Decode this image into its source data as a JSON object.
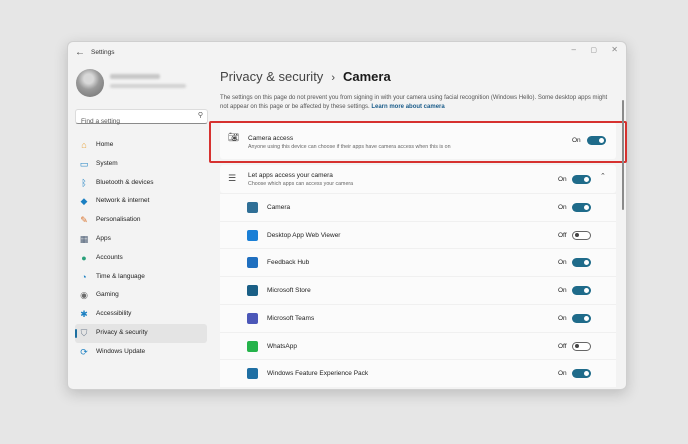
{
  "window": {
    "title": "Settings",
    "controls": {
      "minimize": "–",
      "maximize": "▢",
      "close": "✕"
    }
  },
  "sidebar": {
    "search_placeholder": "Find a setting",
    "items": [
      {
        "label": "Home",
        "icon": "home-icon",
        "color": "#e8a33a",
        "glyph": "⌂"
      },
      {
        "label": "System",
        "icon": "system-icon",
        "color": "#1a7fc2",
        "glyph": "▭"
      },
      {
        "label": "Bluetooth & devices",
        "icon": "bluetooth-icon",
        "color": "#1a7fc2",
        "glyph": "ᛒ"
      },
      {
        "label": "Network & internet",
        "icon": "network-icon",
        "color": "#1a7fc2",
        "glyph": "◆"
      },
      {
        "label": "Personalisation",
        "icon": "brush-icon",
        "color": "#d9722b",
        "glyph": "✎"
      },
      {
        "label": "Apps",
        "icon": "apps-icon",
        "color": "#4a5b72",
        "glyph": "▦"
      },
      {
        "label": "Accounts",
        "icon": "accounts-icon",
        "color": "#2aa07a",
        "glyph": "●"
      },
      {
        "label": "Time & language",
        "icon": "time-language-icon",
        "color": "#1a7fc2",
        "glyph": "◔"
      },
      {
        "label": "Gaming",
        "icon": "gaming-icon",
        "color": "#6b6b6b",
        "glyph": "◉"
      },
      {
        "label": "Accessibility",
        "icon": "accessibility-icon",
        "color": "#1a7fc2",
        "glyph": "✱"
      },
      {
        "label": "Privacy & security",
        "icon": "shield-icon",
        "color": "#6b7a8c",
        "glyph": "⛉",
        "active": true
      },
      {
        "label": "Windows Update",
        "icon": "windows-update-icon",
        "color": "#1a7fc2",
        "glyph": "⟳"
      }
    ]
  },
  "main": {
    "breadcrumb": {
      "parent": "Privacy & security",
      "separator": "›",
      "current": "Camera"
    },
    "description": "The settings on this page do not prevent you from signing in with your camera using facial recognition (Windows Hello). Some desktop apps might not appear on this page or be affected by these settings.",
    "learn_more": "Learn more about camera",
    "camera_access": {
      "title": "Camera access",
      "subtitle": "Anyone using this device can choose if their apps have camera access when this is on",
      "state": "On"
    },
    "let_apps": {
      "title": "Let apps access your camera",
      "subtitle": "Choose which apps can access your camera",
      "state": "On"
    },
    "apps": [
      {
        "name": "Camera",
        "state": "On",
        "on": true,
        "icon": "camera-app-icon",
        "color": "#2f6f96"
      },
      {
        "name": "Desktop App Web Viewer",
        "state": "Off",
        "on": false,
        "icon": "web-viewer-icon",
        "color": "#1a7fd6"
      },
      {
        "name": "Feedback Hub",
        "state": "On",
        "on": true,
        "icon": "feedback-hub-icon",
        "color": "#1f6fbf"
      },
      {
        "name": "Microsoft Store",
        "state": "On",
        "on": true,
        "icon": "store-icon",
        "color": "#1a5f86"
      },
      {
        "name": "Microsoft Teams",
        "state": "On",
        "on": true,
        "icon": "teams-icon",
        "color": "#4b57b8"
      },
      {
        "name": "WhatsApp",
        "state": "Off",
        "on": false,
        "icon": "whatsapp-icon",
        "color": "#25b34b"
      },
      {
        "name": "Windows Feature Experience Pack",
        "state": "On",
        "on": true,
        "icon": "feature-pack-icon",
        "color": "#1f6fa3"
      }
    ]
  }
}
